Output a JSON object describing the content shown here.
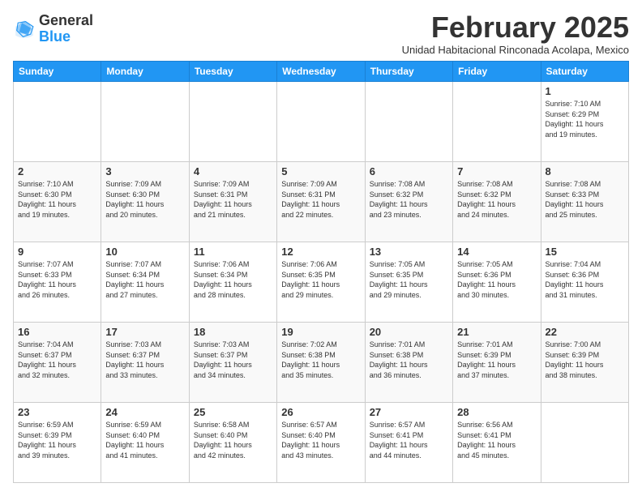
{
  "logo": {
    "general": "General",
    "blue": "Blue"
  },
  "header": {
    "month": "February 2025",
    "location": "Unidad Habitacional Rinconada Acolapa, Mexico"
  },
  "weekdays": [
    "Sunday",
    "Monday",
    "Tuesday",
    "Wednesday",
    "Thursday",
    "Friday",
    "Saturday"
  ],
  "weeks": [
    [
      {
        "day": "",
        "info": ""
      },
      {
        "day": "",
        "info": ""
      },
      {
        "day": "",
        "info": ""
      },
      {
        "day": "",
        "info": ""
      },
      {
        "day": "",
        "info": ""
      },
      {
        "day": "",
        "info": ""
      },
      {
        "day": "1",
        "info": "Sunrise: 7:10 AM\nSunset: 6:29 PM\nDaylight: 11 hours\nand 19 minutes."
      }
    ],
    [
      {
        "day": "2",
        "info": "Sunrise: 7:10 AM\nSunset: 6:30 PM\nDaylight: 11 hours\nand 19 minutes."
      },
      {
        "day": "3",
        "info": "Sunrise: 7:09 AM\nSunset: 6:30 PM\nDaylight: 11 hours\nand 20 minutes."
      },
      {
        "day": "4",
        "info": "Sunrise: 7:09 AM\nSunset: 6:31 PM\nDaylight: 11 hours\nand 21 minutes."
      },
      {
        "day": "5",
        "info": "Sunrise: 7:09 AM\nSunset: 6:31 PM\nDaylight: 11 hours\nand 22 minutes."
      },
      {
        "day": "6",
        "info": "Sunrise: 7:08 AM\nSunset: 6:32 PM\nDaylight: 11 hours\nand 23 minutes."
      },
      {
        "day": "7",
        "info": "Sunrise: 7:08 AM\nSunset: 6:32 PM\nDaylight: 11 hours\nand 24 minutes."
      },
      {
        "day": "8",
        "info": "Sunrise: 7:08 AM\nSunset: 6:33 PM\nDaylight: 11 hours\nand 25 minutes."
      }
    ],
    [
      {
        "day": "9",
        "info": "Sunrise: 7:07 AM\nSunset: 6:33 PM\nDaylight: 11 hours\nand 26 minutes."
      },
      {
        "day": "10",
        "info": "Sunrise: 7:07 AM\nSunset: 6:34 PM\nDaylight: 11 hours\nand 27 minutes."
      },
      {
        "day": "11",
        "info": "Sunrise: 7:06 AM\nSunset: 6:34 PM\nDaylight: 11 hours\nand 28 minutes."
      },
      {
        "day": "12",
        "info": "Sunrise: 7:06 AM\nSunset: 6:35 PM\nDaylight: 11 hours\nand 29 minutes."
      },
      {
        "day": "13",
        "info": "Sunrise: 7:05 AM\nSunset: 6:35 PM\nDaylight: 11 hours\nand 29 minutes."
      },
      {
        "day": "14",
        "info": "Sunrise: 7:05 AM\nSunset: 6:36 PM\nDaylight: 11 hours\nand 30 minutes."
      },
      {
        "day": "15",
        "info": "Sunrise: 7:04 AM\nSunset: 6:36 PM\nDaylight: 11 hours\nand 31 minutes."
      }
    ],
    [
      {
        "day": "16",
        "info": "Sunrise: 7:04 AM\nSunset: 6:37 PM\nDaylight: 11 hours\nand 32 minutes."
      },
      {
        "day": "17",
        "info": "Sunrise: 7:03 AM\nSunset: 6:37 PM\nDaylight: 11 hours\nand 33 minutes."
      },
      {
        "day": "18",
        "info": "Sunrise: 7:03 AM\nSunset: 6:37 PM\nDaylight: 11 hours\nand 34 minutes."
      },
      {
        "day": "19",
        "info": "Sunrise: 7:02 AM\nSunset: 6:38 PM\nDaylight: 11 hours\nand 35 minutes."
      },
      {
        "day": "20",
        "info": "Sunrise: 7:01 AM\nSunset: 6:38 PM\nDaylight: 11 hours\nand 36 minutes."
      },
      {
        "day": "21",
        "info": "Sunrise: 7:01 AM\nSunset: 6:39 PM\nDaylight: 11 hours\nand 37 minutes."
      },
      {
        "day": "22",
        "info": "Sunrise: 7:00 AM\nSunset: 6:39 PM\nDaylight: 11 hours\nand 38 minutes."
      }
    ],
    [
      {
        "day": "23",
        "info": "Sunrise: 6:59 AM\nSunset: 6:39 PM\nDaylight: 11 hours\nand 39 minutes."
      },
      {
        "day": "24",
        "info": "Sunrise: 6:59 AM\nSunset: 6:40 PM\nDaylight: 11 hours\nand 41 minutes."
      },
      {
        "day": "25",
        "info": "Sunrise: 6:58 AM\nSunset: 6:40 PM\nDaylight: 11 hours\nand 42 minutes."
      },
      {
        "day": "26",
        "info": "Sunrise: 6:57 AM\nSunset: 6:40 PM\nDaylight: 11 hours\nand 43 minutes."
      },
      {
        "day": "27",
        "info": "Sunrise: 6:57 AM\nSunset: 6:41 PM\nDaylight: 11 hours\nand 44 minutes."
      },
      {
        "day": "28",
        "info": "Sunrise: 6:56 AM\nSunset: 6:41 PM\nDaylight: 11 hours\nand 45 minutes."
      },
      {
        "day": "",
        "info": ""
      }
    ]
  ]
}
